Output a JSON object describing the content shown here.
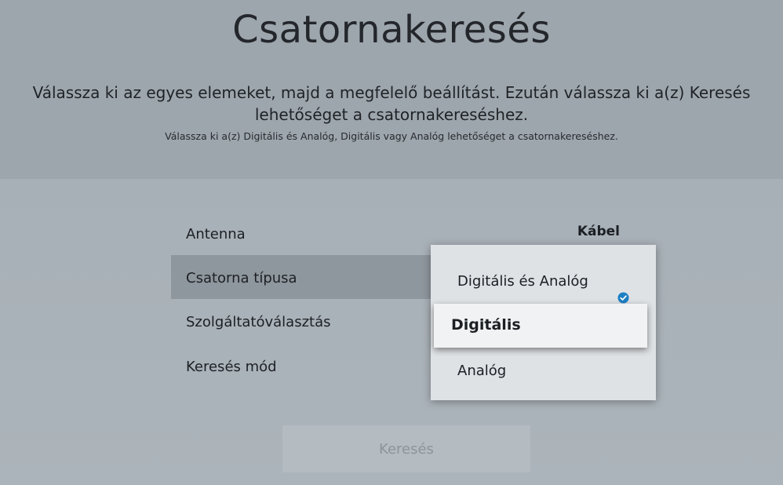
{
  "header": {
    "title": "Csatornakeresés",
    "instruction_line1": "Válassza ki az egyes elemeket, majd a megfelelő beállítást. Ezután válassza ki a(z) Keresés",
    "instruction_line2": "lehetőséget a csatornakereséshez.",
    "hint": "Válassza ki a(z) Digitális és Analóg, Digitális vagy Analóg lehetőséget a csatornakereséshez."
  },
  "settings": {
    "antenna": {
      "label": "Antenna",
      "value": "Kábel"
    },
    "channel_type": {
      "label": "Csatorna típusa"
    },
    "provider": {
      "label": "Szolgáltatóválasztás"
    },
    "search_mode": {
      "label": "Keresés mód"
    }
  },
  "dropdown": {
    "options": [
      {
        "label": "Digitális és Analóg",
        "selected": true
      },
      {
        "label": "Digitális",
        "focused": true
      },
      {
        "label": "Analóg"
      }
    ],
    "check_icon": "checkmark-circle-icon",
    "check_color": "#1e7fc4"
  },
  "search_button": {
    "label": "Keresés",
    "enabled": false
  }
}
